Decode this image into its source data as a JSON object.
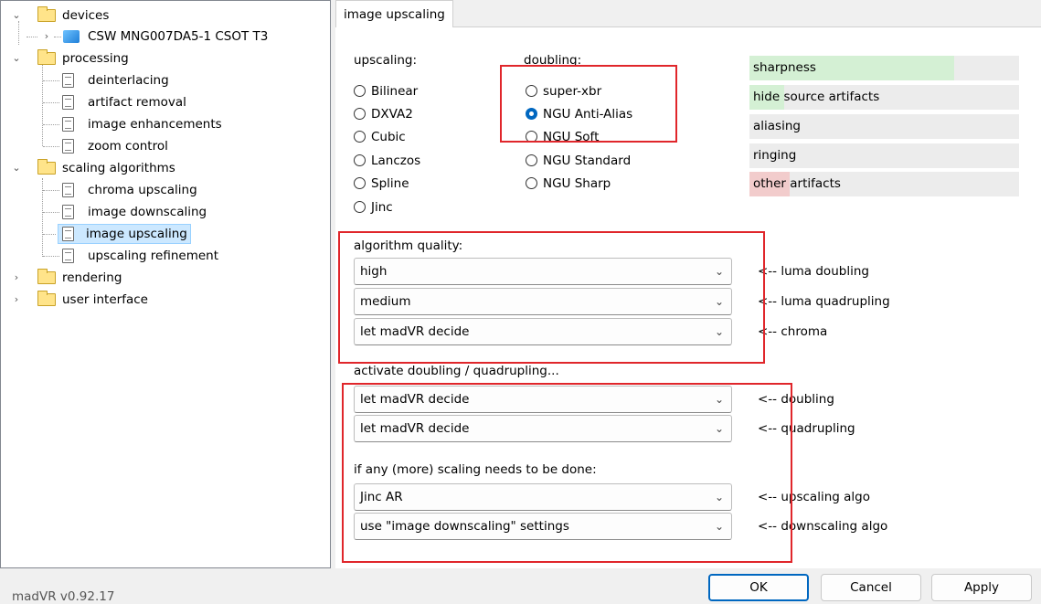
{
  "tree": {
    "devices": "devices",
    "device": "CSW MNG007DA5-1 CSOT T3",
    "processing": "processing",
    "deinterlacing": "deinterlacing",
    "artifact_removal": "artifact removal",
    "image_enhancements": "image enhancements",
    "zoom_control": "zoom control",
    "scaling_algorithms": "scaling algorithms",
    "chroma_upscaling": "chroma upscaling",
    "image_downscaling": "image downscaling",
    "image_upscaling": "image upscaling",
    "upscaling_refinement": "upscaling refinement",
    "rendering": "rendering",
    "user_interface": "user interface"
  },
  "tab": "image upscaling",
  "upscaling": {
    "label": "upscaling:",
    "options": [
      "Bilinear",
      "DXVA2",
      "Cubic",
      "Lanczos",
      "Spline",
      "Jinc"
    ],
    "selected": null
  },
  "doubling": {
    "label": "doubling:",
    "options": [
      "super-xbr",
      "NGU Anti-Alias",
      "NGU Soft",
      "NGU Standard",
      "NGU Sharp"
    ],
    "selected": "NGU Anti-Alias"
  },
  "bars": [
    {
      "label": "sharpness",
      "fill": 0.76,
      "color": "#d4f0d4"
    },
    {
      "label": "hide source artifacts",
      "fill": 0.13,
      "color": "#d4f0d4"
    },
    {
      "label": "aliasing",
      "fill": 0.0,
      "color": "#d4f0d4"
    },
    {
      "label": "ringing",
      "fill": 0.0,
      "color": "#d4f0d4"
    },
    {
      "label": "other artifacts",
      "fill": 0.15,
      "color": "#f2cccc"
    }
  ],
  "quality": {
    "label": "algorithm quality:",
    "rows": [
      {
        "value": "high",
        "note": "<-- luma doubling"
      },
      {
        "value": "medium",
        "note": "<-- luma quadrupling"
      },
      {
        "value": "let madVR decide",
        "note": "<-- chroma"
      }
    ]
  },
  "activate": {
    "label": "activate doubling / quadrupling...",
    "rows": [
      {
        "value": "let madVR decide",
        "note": "<-- doubling"
      },
      {
        "value": "let madVR decide",
        "note": "<-- quadrupling"
      }
    ]
  },
  "more_scaling": {
    "label": "if any (more) scaling needs to be done:",
    "rows": [
      {
        "value": "Jinc AR",
        "note": "<-- upscaling algo"
      },
      {
        "value": "use \"image downscaling\" settings",
        "note": "<-- downscaling algo"
      }
    ]
  },
  "version": "madVR v0.92.17",
  "buttons": {
    "ok": "OK",
    "cancel": "Cancel",
    "apply": "Apply"
  },
  "colors": {
    "highlight": "#e0262b",
    "accent": "#0067c0"
  }
}
